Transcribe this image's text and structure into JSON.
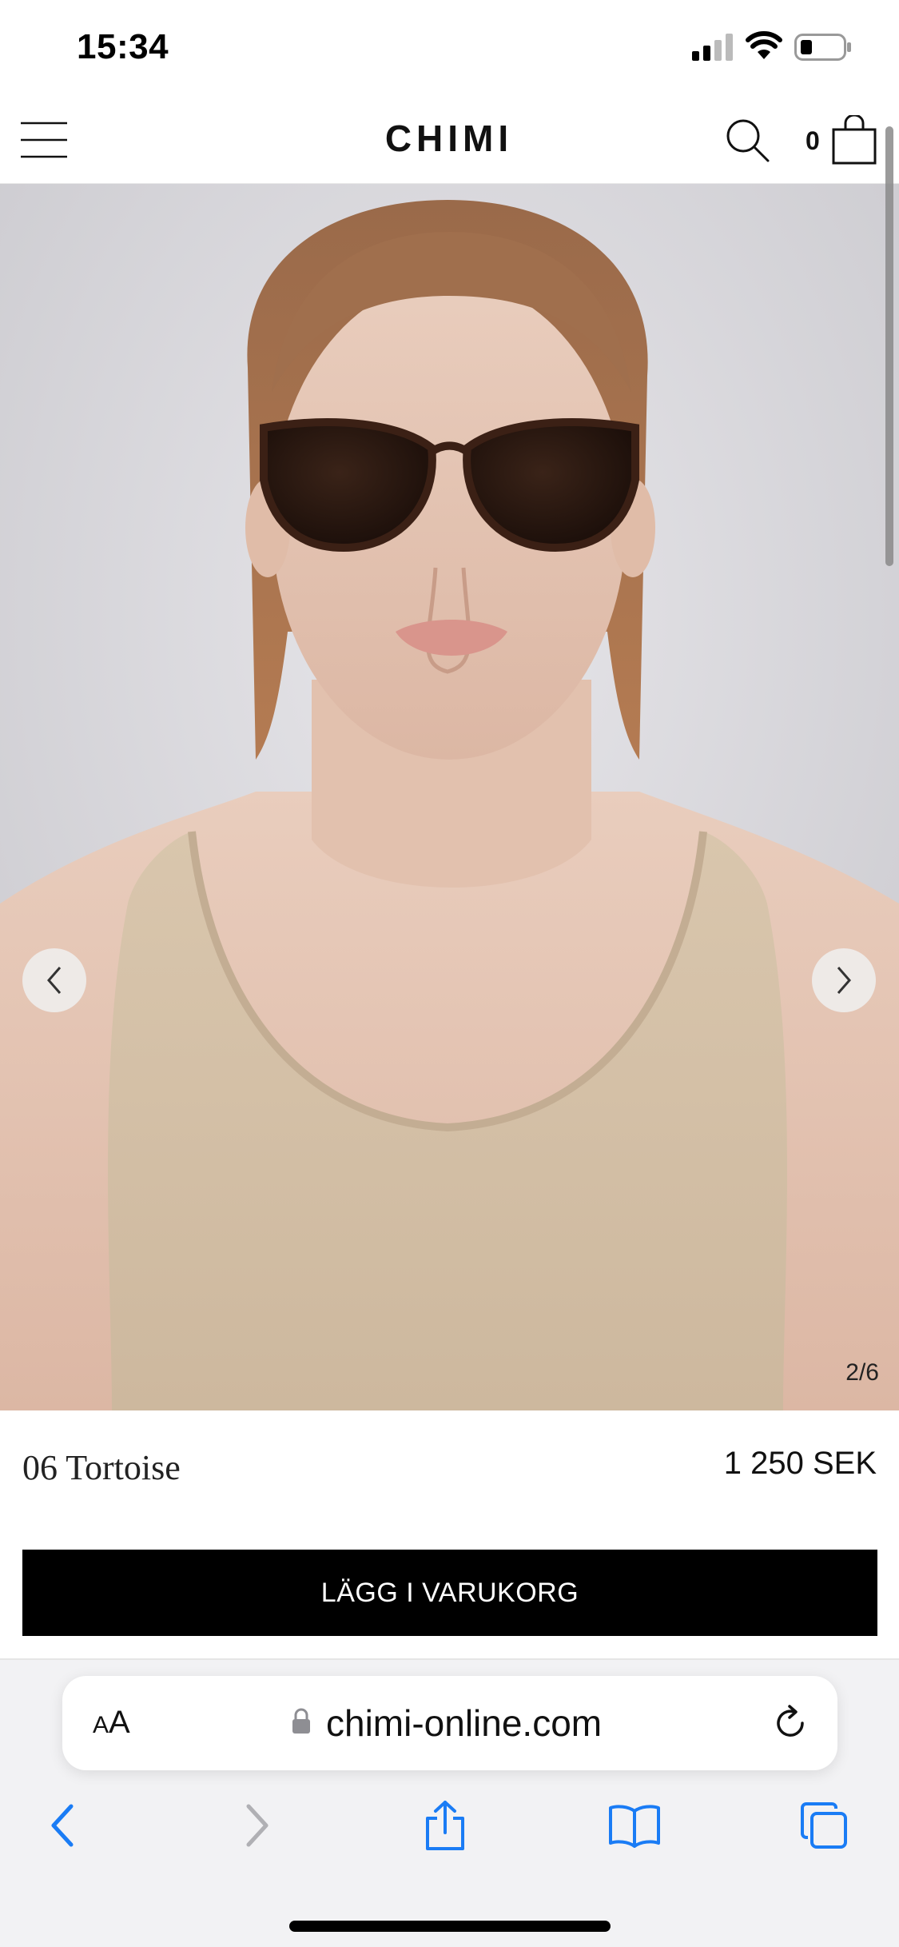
{
  "status_bar": {
    "time": "15:34"
  },
  "header": {
    "brand": "CHIMI",
    "cart_count": "0"
  },
  "gallery": {
    "counter": "2/6",
    "current_index": 2,
    "total": 6
  },
  "product": {
    "name": "06 Tortoise",
    "price": "1 250 SEK",
    "add_to_cart_label": "LÄGG I VARUKORG"
  },
  "browser": {
    "aa_large": "A",
    "aa_small": "A",
    "url": "chimi-online.com"
  },
  "colors": {
    "accent": "#1a7cf5",
    "button_bg": "#000000",
    "button_text": "#ffffff",
    "toolbar_disabled": "#b0b0b4"
  }
}
